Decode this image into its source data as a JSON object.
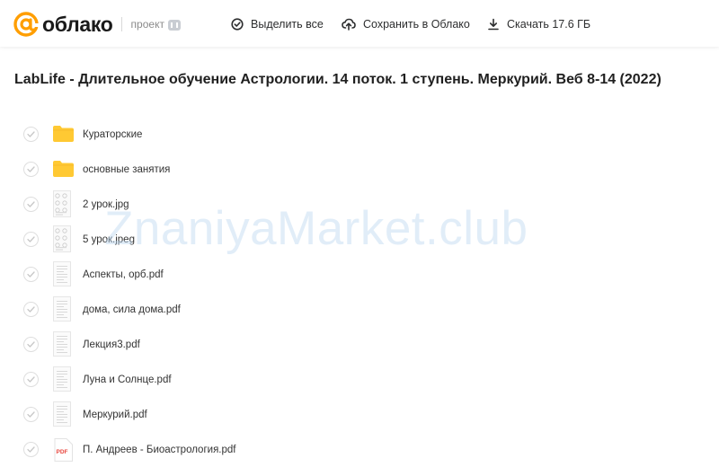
{
  "header": {
    "logo_text": "облако",
    "project_label": "проект",
    "select_all_label": "Выделить все",
    "save_label": "Сохранить в Облако",
    "download_label": "Скачать 17.6 ГБ"
  },
  "page_title": "LabLife - Длительное обучение Астрологии. 14 поток. 1 ступень. Меркурий. Веб 8-14 (2022)",
  "files": [
    {
      "name": "Кураторские",
      "type": "folder"
    },
    {
      "name": "основные занятия",
      "type": "folder"
    },
    {
      "name": "2 урок.jpg",
      "type": "image"
    },
    {
      "name": "5 урок.jpeg",
      "type": "image"
    },
    {
      "name": "Аспекты, орб.pdf",
      "type": "doc"
    },
    {
      "name": "дома, сила дома.pdf",
      "type": "doc"
    },
    {
      "name": "Лекция3.pdf",
      "type": "doc"
    },
    {
      "name": "Луна и Солнце.pdf",
      "type": "doc"
    },
    {
      "name": "Меркурий.pdf",
      "type": "doc"
    },
    {
      "name": "П. Андреев - Биоастрология.pdf",
      "type": "pdf"
    }
  ],
  "pdf_badge": "PDF",
  "watermark": "ZnaniyaMarket.club",
  "colors": {
    "brand_orange": "#FF9E00",
    "folder_yellow": "#FFC933",
    "pdf_red": "#E8473F"
  }
}
